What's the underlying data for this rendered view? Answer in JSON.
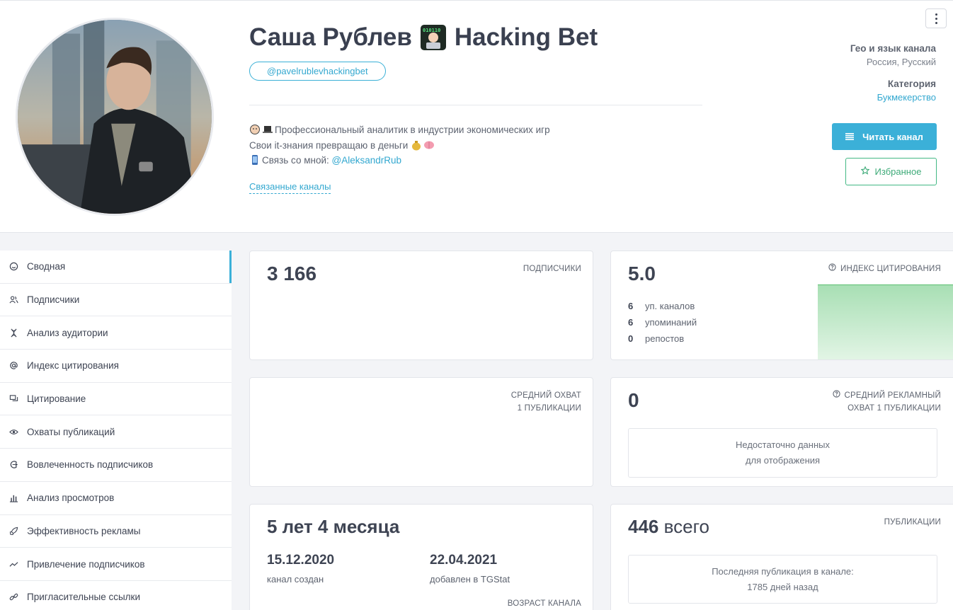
{
  "channel": {
    "title": "Саша Рублев",
    "title_suffix": "Hacking Bet",
    "username": "@pavelrublevhackingbet",
    "description_line1": "Профессиональный аналитик в индустрии экономических игр",
    "description_line2": "Свои it-знания превращаю в деньги",
    "description_line3_prefix": "Связь со мной:",
    "description_contact": "@AleksandrRub",
    "linked_channels": "Связанные каналы"
  },
  "meta": {
    "geo_label": "Гео и язык канала",
    "geo_value": "Россия, Русский",
    "category_label": "Категория",
    "category_value": "Букмекерство"
  },
  "buttons": {
    "read": "Читать канал",
    "favorite": "Избранное"
  },
  "sidebar": {
    "items": [
      {
        "label": "Сводная",
        "icon": "smile-icon"
      },
      {
        "label": "Подписчики",
        "icon": "users-icon"
      },
      {
        "label": "Анализ аудитории",
        "icon": "dna-icon"
      },
      {
        "label": "Индекс цитирования",
        "icon": "at-icon"
      },
      {
        "label": "Цитирование",
        "icon": "quote-icon"
      },
      {
        "label": "Охваты публикаций",
        "icon": "eye-icon"
      },
      {
        "label": "Вовлеченность подписчиков",
        "icon": "engagement-icon"
      },
      {
        "label": "Анализ просмотров",
        "icon": "bar-chart-icon"
      },
      {
        "label": "Эффективность рекламы",
        "icon": "rocket-icon"
      },
      {
        "label": "Привлечение подписчиков",
        "icon": "trend-icon"
      },
      {
        "label": "Пригласительные ссылки",
        "icon": "link-icon"
      }
    ]
  },
  "cards": {
    "subscribers": {
      "value": "3 166",
      "caption": "ПОДПИСЧИКИ"
    },
    "citation": {
      "value": "5.0",
      "caption": "ИНДЕКС ЦИТИРОВАНИЯ",
      "rows": [
        {
          "num": "6",
          "label": "уп. каналов"
        },
        {
          "num": "6",
          "label": "упоминаний"
        },
        {
          "num": "0",
          "label": "репостов"
        }
      ]
    },
    "avg_reach": {
      "caption1": "СРЕДНИЙ ОХВАТ",
      "caption2": "1 ПУБЛИКАЦИИ"
    },
    "ad_reach": {
      "value": "0",
      "caption1": "СРЕДНИЙ РЕКЛАМНЫЙ",
      "caption2": "ОХВАТ 1 ПУБЛИКАЦИИ",
      "note1": "Недостаточно данных",
      "note2": "для отображения"
    },
    "age": {
      "value": "5 лет 4 месяца",
      "created_date": "15.12.2020",
      "created_label": "канал создан",
      "added_date": "22.04.2021",
      "added_label": "добавлен в TGStat",
      "caption": "ВОЗРАСТ КАНАЛА"
    },
    "posts": {
      "value_num": "446",
      "value_word": "всего",
      "caption": "ПУБЛИКАЦИИ",
      "note1": "Последняя публикация в канале:",
      "note2": "1785 дней назад"
    }
  }
}
